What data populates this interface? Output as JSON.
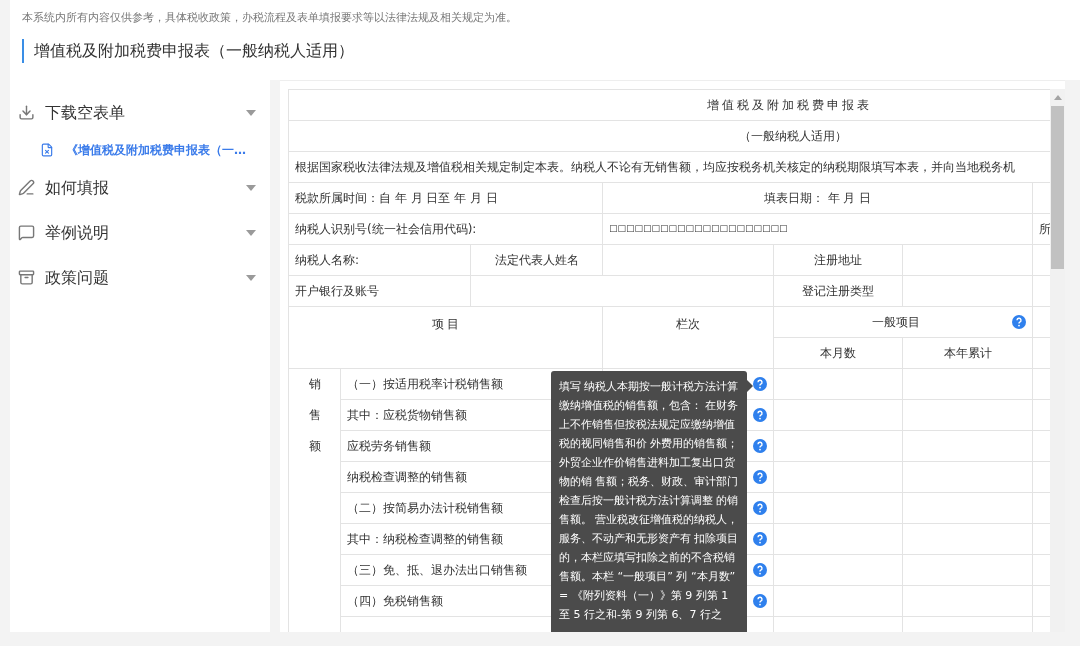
{
  "notice": "本系统内所有内容仅供参考，具体税收政策，办税流程及表单填报要求等以法律法规及相关规定为准。",
  "page_title": "增值税及附加税费申报表（一般纳税人适用）",
  "sidebar": [
    {
      "label": "下载空表单",
      "kind": "download",
      "children": [
        {
          "label": "《增值税及附加税费申报表（一…",
          "kind": "file"
        }
      ]
    },
    {
      "label": "如何填报",
      "kind": "edit"
    },
    {
      "label": "举例说明",
      "kind": "example"
    },
    {
      "label": "政策问题",
      "kind": "policy"
    }
  ],
  "form": {
    "title": "增值税及附加税费申报表",
    "subtitle": "（一般纳税人适用）",
    "intro": "根据国家税收法律法规及增值税相关规定制定本表。纳税人不论有无销售额，均应按税务机关核定的纳税期限填写本表，并向当地税务机",
    "period": "税款所属时间：自 年 月 日至 年 月 日",
    "fill_date": "填表日期： 年 月 日",
    "taxpayer_id_label": "纳税人识别号(统一社会信用代码):",
    "taxpayer_id_value": "□□□□□□□□□□□□□□□□□□□□□",
    "id_row_cut": "所",
    "name_label": "纳税人名称:",
    "legal_rep_label": "法定代表人姓名",
    "address_label": "注册地址",
    "bank_label": "开户银行及账号",
    "reg_type_label": "登记注册类型",
    "columns": {
      "item": "项 目",
      "line": "栏次",
      "general": "一般项目",
      "month": "本月数",
      "year": "本年累计"
    },
    "group_label": "销售额",
    "rows": [
      {
        "item": "（一）按适用税率计税销售额"
      },
      {
        "item": "其中：应税货物销售额"
      },
      {
        "item": "应税劳务销售额"
      },
      {
        "item": "纳税检查调整的销售额"
      },
      {
        "item": "（二）按简易办法计税销售额"
      },
      {
        "item": "其中：纳税检查调整的销售额"
      },
      {
        "item": "（三）免、抵、退办法出口销售额"
      },
      {
        "item": "（四）免税销售额"
      }
    ]
  },
  "tooltip": "填写 纳税人本期按一般计税方法计算缴纳增值税的销售额，包含： 在财务上不作销售但按税法规定应缴纳增值税的视同销售和价 外费用的销售额；外贸企业作价销售进料加工复出口货物的销 售额；税务、财政、审计部门检查后按一般计税方法计算调整 的销售额。 营业税改征增值税的纳税人，服务、不动产和无形资产有 扣除项目的，本栏应填写扣除之前的不含税销售额。本栏 “一般项目” 列 “本月数” = 《附列资料（一）》第 9 列第 1 至 5 行之和-第 9 列第 6、7 行之"
}
